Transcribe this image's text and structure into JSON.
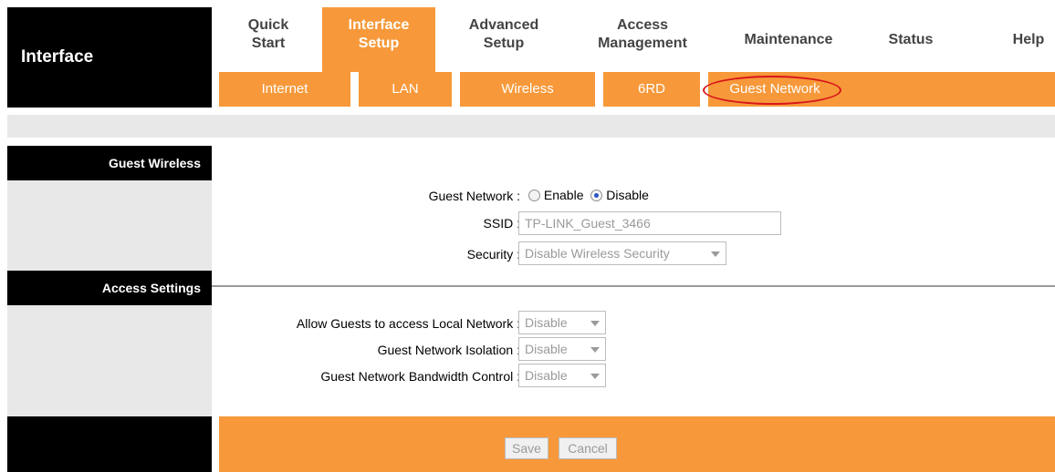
{
  "brand": {
    "title": "Interface"
  },
  "nav": {
    "tabs": [
      {
        "line1": "Quick",
        "line2": "Start"
      },
      {
        "line1": "Interface",
        "line2": "Setup"
      },
      {
        "line1": "Advanced",
        "line2": "Setup"
      },
      {
        "line1": "Access",
        "line2": "Management"
      },
      {
        "label": "Maintenance"
      },
      {
        "label": "Status"
      },
      {
        "label": "Help"
      }
    ],
    "subtabs": [
      "Internet",
      "LAN",
      "Wireless",
      "6RD",
      "Guest Network"
    ]
  },
  "guest_wireless": {
    "heading": "Guest Wireless",
    "guest_network_label": "Guest Network :",
    "enable_label": "Enable",
    "disable_label": "Disable",
    "selected": "Disable",
    "ssid_label": "SSID :",
    "ssid_value": "TP-LINK_Guest_3466",
    "security_label": "Security :",
    "security_value": "Disable Wireless Security"
  },
  "access_settings": {
    "heading": "Access Settings",
    "local_network_label": "Allow Guests to access Local Network :",
    "local_network_value": "Disable",
    "isolation_label": "Guest Network Isolation :",
    "isolation_value": "Disable",
    "bandwidth_label": "Guest Network Bandwidth Control :",
    "bandwidth_value": "Disable"
  },
  "footer": {
    "save_label": "Save",
    "cancel_label": "Cancel"
  },
  "colors": {
    "accent": "#f7993a",
    "highlight_ring": "#d8161b"
  }
}
